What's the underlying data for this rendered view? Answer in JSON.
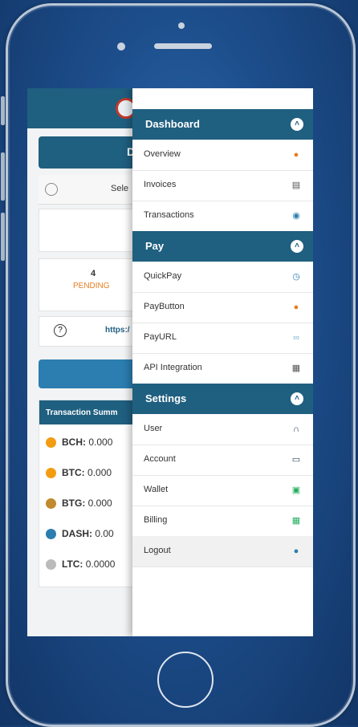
{
  "drawer": {
    "sections": [
      {
        "title": "Dashboard",
        "items": [
          {
            "label": "Overview",
            "icon": "overview-icon"
          },
          {
            "label": "Invoices",
            "icon": "invoice-icon"
          },
          {
            "label": "Transactions",
            "icon": "transactions-icon"
          }
        ]
      },
      {
        "title": "Pay",
        "items": [
          {
            "label": "QuickPay",
            "icon": "quickpay-icon"
          },
          {
            "label": "PayButton",
            "icon": "paybutton-icon"
          },
          {
            "label": "PayURL",
            "icon": "link-icon"
          },
          {
            "label": "API Integration",
            "icon": "api-icon"
          }
        ]
      },
      {
        "title": "Settings",
        "items": [
          {
            "label": "User",
            "icon": "user-icon"
          },
          {
            "label": "Account",
            "icon": "account-icon"
          },
          {
            "label": "Wallet",
            "icon": "wallet-icon"
          },
          {
            "label": "Billing",
            "icon": "billing-icon"
          },
          {
            "label": "Logout",
            "icon": "logout-icon"
          }
        ]
      }
    ]
  },
  "background": {
    "dashboard_button": "D",
    "select_label": "Sele",
    "pending_count": "4",
    "pending_label": "PENDING",
    "link_text": "https:/",
    "tx_title": "Transaction Summ",
    "coins": [
      {
        "symbol": "BCH:",
        "value": "0.000",
        "color": "#f39c12"
      },
      {
        "symbol": "BTC:",
        "value": "0.000",
        "color": "#f39c12"
      },
      {
        "symbol": "BTG:",
        "value": "0.000",
        "color": "#c08a2e"
      },
      {
        "symbol": "DASH:",
        "value": "0.00",
        "color": "#2c7db0"
      },
      {
        "symbol": "LTC:",
        "value": "0.0000",
        "color": "#bbbbbb"
      }
    ]
  },
  "colors": {
    "accent": "#1f5f80"
  }
}
